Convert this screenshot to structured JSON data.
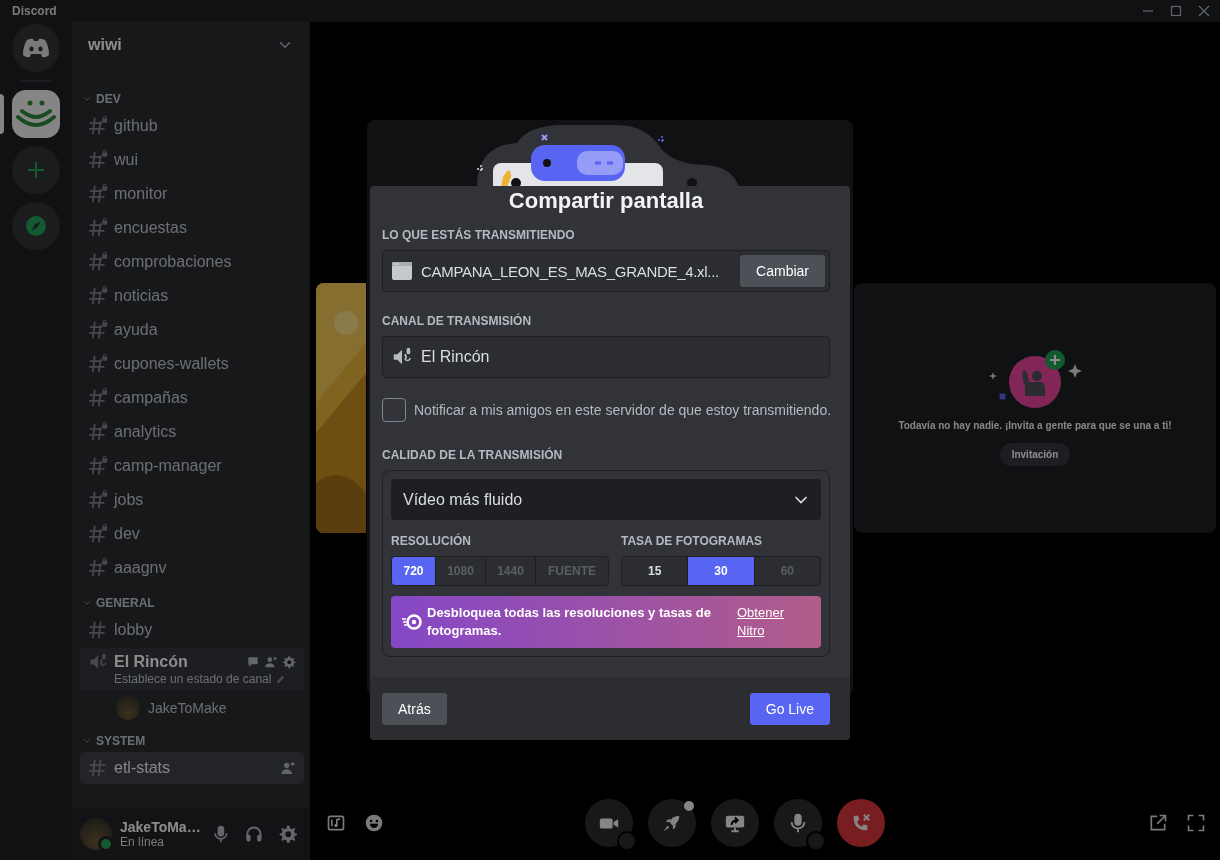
{
  "window": {
    "title": "Discord"
  },
  "servers": [
    {
      "kind": "home",
      "selected": false
    },
    {
      "kind": "server",
      "selected": true
    },
    {
      "kind": "add",
      "selected": false
    },
    {
      "kind": "explore",
      "selected": false
    }
  ],
  "server_name": "wiwi",
  "categories": [
    {
      "name": "DEV",
      "channels": [
        {
          "kind": "text",
          "name": "github",
          "locked": true,
          "selected": false
        },
        {
          "kind": "text",
          "name": "wui",
          "locked": true,
          "selected": false
        },
        {
          "kind": "text",
          "name": "monitor",
          "locked": true,
          "selected": false
        },
        {
          "kind": "text",
          "name": "encuestas",
          "locked": true,
          "selected": false
        },
        {
          "kind": "text",
          "name": "comprobaciones",
          "locked": true,
          "selected": false
        },
        {
          "kind": "text",
          "name": "noticias",
          "locked": true,
          "selected": false
        },
        {
          "kind": "text",
          "name": "ayuda",
          "locked": true,
          "selected": false
        },
        {
          "kind": "text",
          "name": "cupones-wallets",
          "locked": true,
          "selected": false
        },
        {
          "kind": "text",
          "name": "campañas",
          "locked": true,
          "selected": false
        },
        {
          "kind": "text",
          "name": "analytics",
          "locked": true,
          "selected": false
        },
        {
          "kind": "text",
          "name": "camp-manager",
          "locked": true,
          "selected": false
        },
        {
          "kind": "text",
          "name": "jobs",
          "locked": true,
          "selected": false
        },
        {
          "kind": "text",
          "name": "dev",
          "locked": true,
          "selected": false
        },
        {
          "kind": "text",
          "name": "aaagnv",
          "locked": true,
          "selected": false
        }
      ]
    },
    {
      "name": "GENERAL",
      "channels": [
        {
          "kind": "text",
          "name": "lobby",
          "locked": false,
          "selected": false
        },
        {
          "kind": "voice",
          "name": "El Rincón",
          "selected": true,
          "status": "Establece un estado de canal",
          "members": [
            {
              "name": "JakeToMake"
            }
          ]
        }
      ]
    },
    {
      "name": "SYSTEM",
      "channels": [
        {
          "kind": "text",
          "name": "etl-stats",
          "locked": false,
          "selected": true
        }
      ]
    }
  ],
  "user": {
    "name": "JakeToMa…",
    "status": "En línea"
  },
  "stage": {
    "message": "Todavía no hay nadie. ¡Invita a gente para que se una a ti!",
    "invite_button": "Invitación"
  },
  "modal": {
    "title": "Compartir pantalla",
    "source_label": "LO QUE ESTÁS TRANSMITIENDO",
    "source_name": "CAMPANA_LEON_ES_MAS_GRANDE_4.xl...",
    "change_button": "Cambiar",
    "channel_label": "CANAL DE TRANSMISIÓN",
    "channel_name": "El Rincón",
    "notify": {
      "label": "Notificar a mis amigos en este servidor de que estoy transmitiendo.",
      "checked": false
    },
    "quality_label": "CALIDAD DE LA TRANSMISIÓN",
    "preset": "Vídeo más fluido",
    "resolution_label": "RESOLUCIÓN",
    "resolutions": [
      {
        "label": "720",
        "selected": true,
        "disabled": false
      },
      {
        "label": "1080",
        "selected": false,
        "disabled": true
      },
      {
        "label": "1440",
        "selected": false,
        "disabled": true
      },
      {
        "label": "FUENTE",
        "selected": false,
        "disabled": true
      }
    ],
    "fps_label": "TASA DE FOTOGRAMAS",
    "fps": [
      {
        "label": "15",
        "selected": false,
        "disabled": false
      },
      {
        "label": "30",
        "selected": true,
        "disabled": false
      },
      {
        "label": "60",
        "selected": false,
        "disabled": true
      }
    ],
    "nitro": {
      "text": "Desbloquea todas las resoluciones y tasas de fotogramas.",
      "link": "Obtener Nitro"
    },
    "back_button": "Atrás",
    "go_live_button": "Go Live"
  }
}
